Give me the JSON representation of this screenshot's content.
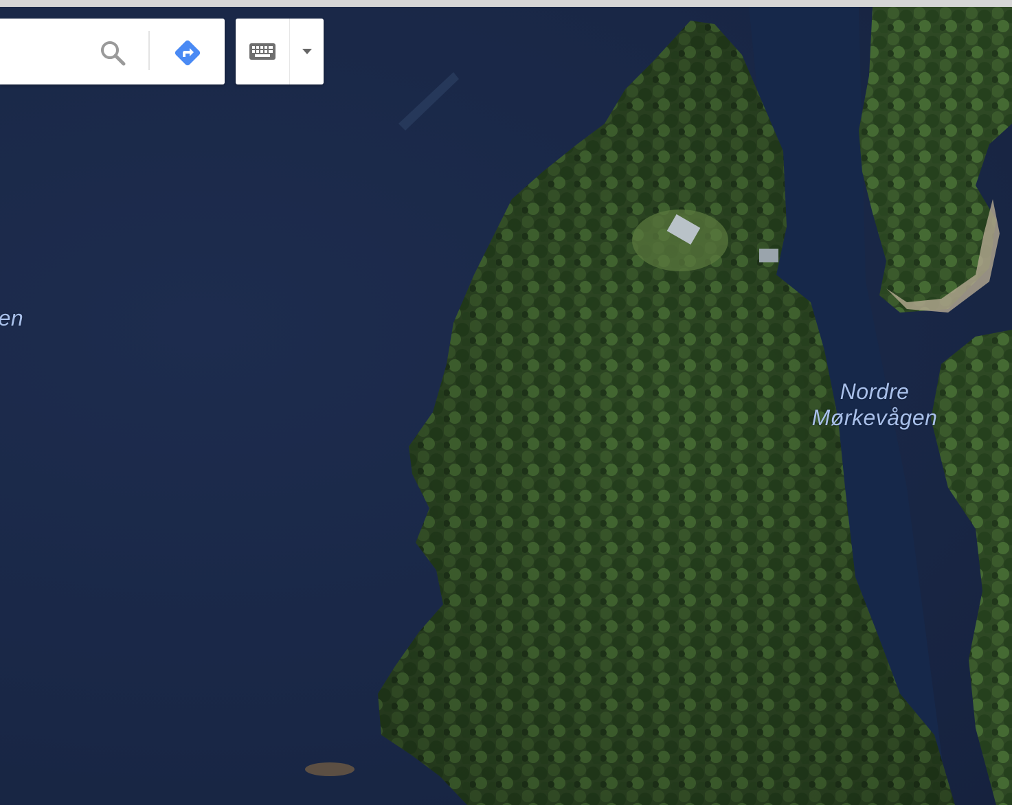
{
  "search": {
    "value": "",
    "placeholder": "",
    "search_icon": "search-icon",
    "directions_icon": "directions-icon"
  },
  "input_tools": {
    "keyboard_icon": "keyboard-icon",
    "dropdown_icon": "caret-down-icon"
  },
  "map": {
    "type": "satellite",
    "labels": {
      "left_partial": "len",
      "right_line1": "Nordre",
      "right_line2": "Mørkevågen"
    }
  },
  "colors": {
    "water": "#1b2a4a",
    "forest": "#2f4a26",
    "label": "#a9c0ea",
    "directions_blue": "#4a8af4"
  }
}
